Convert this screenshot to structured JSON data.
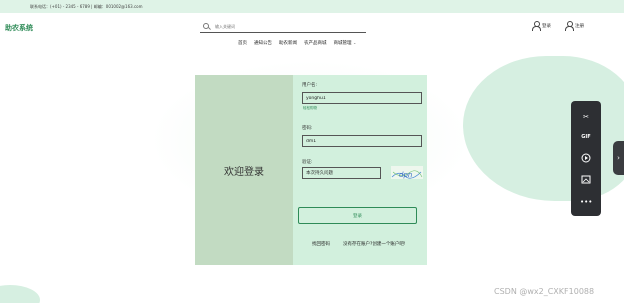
{
  "topstrip": {
    "text": "联系电话：(+01) - 2345 - 6789 | 邮编：001002@163.com"
  },
  "header": {
    "logo": "助农系统",
    "search": {
      "placeholder": "输入关键词"
    },
    "login_label": "登录",
    "register_label": "注册",
    "nav": [
      "首页",
      "通知公告",
      "助农新闻",
      "农产品商城",
      "商城管理"
    ]
  },
  "login_panel": {
    "welcome": "欢迎登录",
    "username": {
      "label": "用户名:",
      "value": "yonghu1",
      "hint": "轻松购物"
    },
    "password": {
      "label": "密码:",
      "value": "dm1"
    },
    "captcha": {
      "label": "验证:",
      "placeholder": "本次持久问题",
      "image_text": "dpn"
    },
    "submit": "登录",
    "forgot": "找回密码",
    "register_link": "没有存在账户?创建一个账户吧!"
  },
  "toolbar": {
    "icons": [
      "scissors-icon",
      "gif-icon",
      "play-icon",
      "image-icon",
      "more-icon"
    ],
    "gif_label": "GIF",
    "more_label": "•••"
  },
  "watermark": "CSDN @wx2_CXKF10088",
  "colors": {
    "accent": "#2e8b57",
    "panel_left": "#c2dbc2",
    "panel_right": "#d2f0dd",
    "strip": "#dff3e7"
  }
}
